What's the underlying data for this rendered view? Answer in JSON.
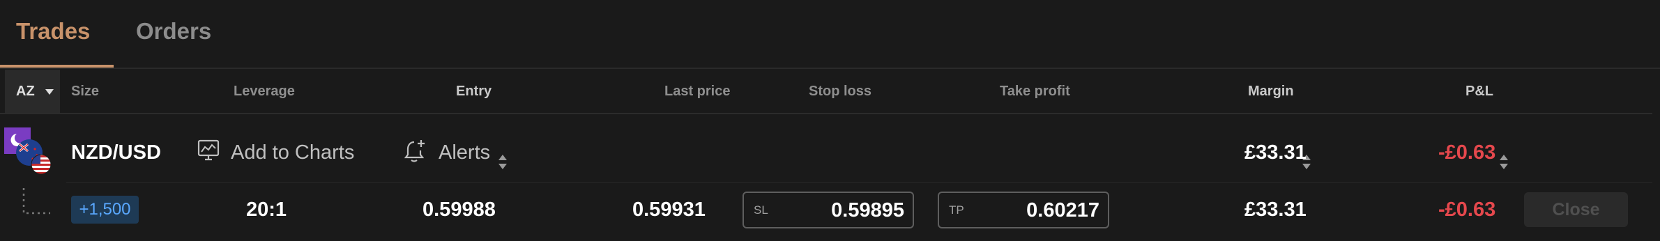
{
  "tabs": [
    {
      "label": "Trades",
      "active": true
    },
    {
      "label": "Orders",
      "active": false
    }
  ],
  "columns": {
    "sort": "AZ",
    "size": "Size",
    "leverage": "Leverage",
    "entry": "Entry",
    "last_price": "Last price",
    "stop_loss": "Stop loss",
    "take_profit": "Take profit",
    "margin": "Margin",
    "pnl": "P&L"
  },
  "position": {
    "symbol": "NZD/USD",
    "add_to_charts": "Add to Charts",
    "alerts": "Alerts",
    "margin": "£33.31",
    "pnl": "-£0.63"
  },
  "trade": {
    "size": "+1,500",
    "leverage": "20:1",
    "entry": "0.59988",
    "last_price": "0.59931",
    "sl_tag": "SL",
    "stop_loss": "0.59895",
    "tp_tag": "TP",
    "take_profit": "0.60217",
    "margin": "£33.31",
    "pnl": "-£0.63",
    "close_label": "Close"
  },
  "colors": {
    "accent": "#c8926a",
    "negative": "#e5484d",
    "size_badge_text": "#5aa8ff",
    "background": "#1a1a1a"
  },
  "icons": [
    "moon-icon",
    "flag-new-zealand-icon",
    "flag-usa-icon",
    "chart-monitor-icon",
    "bell-plus-icon",
    "sort-caret-icon",
    "tree-connector-icon"
  ]
}
